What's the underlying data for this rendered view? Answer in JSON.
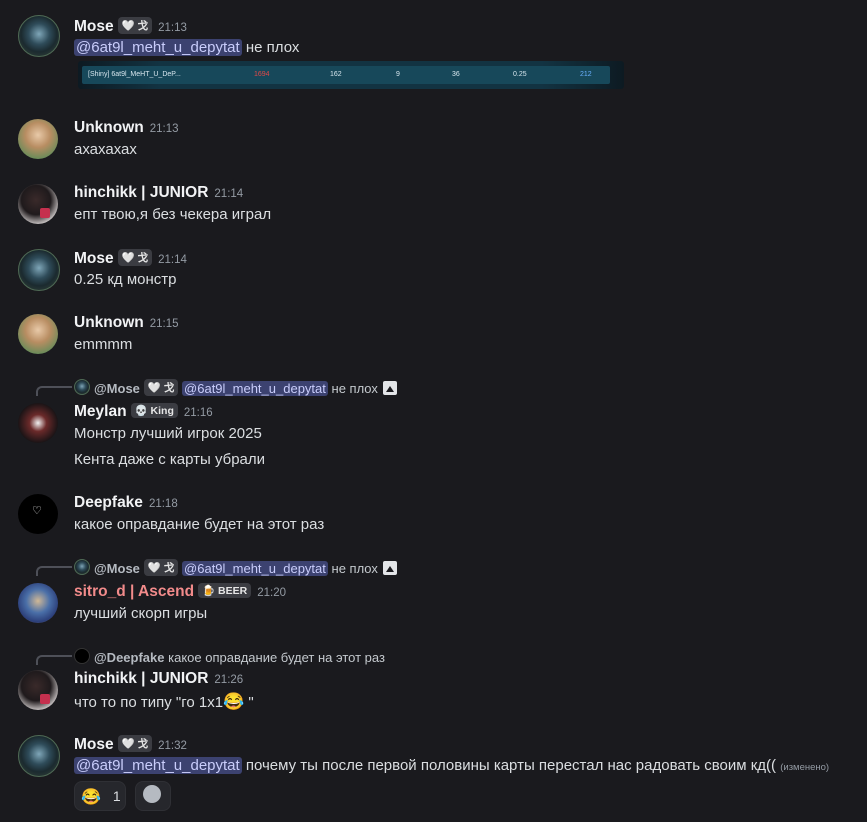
{
  "colors": {
    "background": "#1a1a1e",
    "mention_bg": "#3c4270",
    "mention_fg": "#c9cdfb",
    "pink_name": "#f28b8b"
  },
  "messages": [
    {
      "author": "Mose",
      "tag": "🤍 戈",
      "time": "21:13",
      "mention": "@6at9l_meht_u_depytat",
      "text": "не плох"
    },
    {
      "author": "Unknown",
      "time": "21:13",
      "text": "ахахахах"
    },
    {
      "author": "hinchikk | JUNIOR",
      "time": "21:14",
      "text": "епт твою,я без чекера играл"
    },
    {
      "author": "Mose",
      "tag": "🤍 戈",
      "time": "21:14",
      "text": "0.25 кд монстр"
    },
    {
      "author": "Unknown",
      "time": "21:15",
      "text": "emmmm"
    },
    {
      "author": "Meylan",
      "tag": "💀 King",
      "time": "21:16",
      "reply": {
        "name": "@Mose",
        "tag": "🤍 戈",
        "mention": "@6at9l_meht_u_depytat",
        "text": "не плох"
      },
      "text": "Монстр лучший игрок 2025",
      "text2": "Кента даже с карты убрали"
    },
    {
      "author": "Deepfake",
      "time": "21:18",
      "text": "какое оправдание будет на этот раз"
    },
    {
      "author": "sitro_d | Ascend",
      "tag": "🍺 BEER",
      "time": "21:20",
      "reply": {
        "name": "@Mose",
        "tag": "🤍 戈",
        "mention": "@6at9l_meht_u_depytat",
        "text": "не плох"
      },
      "text": "лучший скорп игры"
    },
    {
      "author": "hinchikk | JUNIOR",
      "time": "21:26",
      "reply": {
        "name": "@Deepfake",
        "text": "какое оправдание будет на этот раз"
      },
      "text": "что то по типу \"го 1х1",
      "emoji": "😂",
      "text_after": " \""
    },
    {
      "author": "Mose",
      "tag": "🤍 戈",
      "time": "21:32",
      "mention": "@6at9l_meht_u_depytat",
      "text": "почему ты после первой половины карты перестал нас радовать своим кд((",
      "edited": "(изменено)",
      "reactions": [
        {
          "emoji": "😂",
          "count": "1"
        }
      ]
    }
  ],
  "embed": {
    "player": "[Shiny] 6at9l_MeHT_U_DeP...",
    "cols": [
      "1694",
      "162",
      "9",
      "36",
      "0.25",
      "212"
    ]
  }
}
